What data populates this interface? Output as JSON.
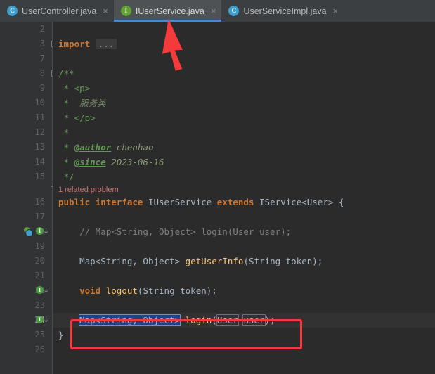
{
  "window": {
    "app": "IntelliJ IDEA",
    "editor_background": "#2b2b2b",
    "gutter_background": "#313335",
    "tabbar_background": "#3c3f41",
    "active_tab_background": "#4e5254",
    "accent": "#4a88c7",
    "annotation_color": "#f43a3a"
  },
  "tabs": [
    {
      "label": "UserController.java",
      "icon": "java-class-icon",
      "icon_letter": "C",
      "icon_kind": "cls",
      "active": false,
      "close_glyph": "×"
    },
    {
      "label": "IUserService.java",
      "icon": "java-interface-icon",
      "icon_letter": "I",
      "icon_kind": "iface",
      "active": true,
      "close_glyph": "×"
    },
    {
      "label": "UserServiceImpl.java",
      "icon": "java-class-icon",
      "icon_letter": "C",
      "icon_kind": "cls",
      "active": false,
      "close_glyph": "×"
    }
  ],
  "editor": {
    "inlay_hint": "1 related problem",
    "folded_placeholder": "...",
    "lines": [
      {
        "n": "2",
        "text": ""
      },
      {
        "n": "3",
        "text": "import ..."
      },
      {
        "n": "7",
        "text": ""
      },
      {
        "n": "8",
        "text": "/**"
      },
      {
        "n": "9",
        "text": " * <p>"
      },
      {
        "n": "10",
        "text": " *  服务类"
      },
      {
        "n": "11",
        "text": " * </p>"
      },
      {
        "n": "12",
        "text": " *"
      },
      {
        "n": "13",
        "text": " * @author chenhao"
      },
      {
        "n": "14",
        "text": " * @since 2023-06-16"
      },
      {
        "n": "15",
        "text": " */"
      },
      {
        "n": "16",
        "text": "public interface IUserService extends IService<User> {"
      },
      {
        "n": "17",
        "text": ""
      },
      {
        "n": "18",
        "text": "    // Map<String, Object> login(User user);"
      },
      {
        "n": "19",
        "text": ""
      },
      {
        "n": "20",
        "text": "    Map<String, Object> getUserInfo(String token);"
      },
      {
        "n": "21",
        "text": ""
      },
      {
        "n": "22",
        "text": "    void logout(String token);"
      },
      {
        "n": "23",
        "text": ""
      },
      {
        "n": "24",
        "text": "    Map<String, Object> login(User user);"
      },
      {
        "n": "25",
        "text": "}"
      },
      {
        "n": "26",
        "text": ""
      }
    ],
    "javadoc": {
      "author_tag": "@author",
      "author_value": "chenhao",
      "since_tag": "@since",
      "since_value": "2023-06-16",
      "body_text": "服务类",
      "open_p": "<p>",
      "close_p": "</p>"
    },
    "declaration": {
      "modifier": "public",
      "keyword": "interface",
      "name": "IUserService",
      "extends_kw": "extends",
      "supertype": "IService<User>",
      "brace": "{"
    },
    "methods": [
      {
        "line": "18",
        "commented": true,
        "return_type": "Map<String, Object>",
        "name": "login",
        "params": "User user"
      },
      {
        "line": "20",
        "commented": false,
        "return_type": "Map<String, Object>",
        "name": "getUserInfo",
        "params": "String token"
      },
      {
        "line": "22",
        "commented": false,
        "return_type": "void",
        "name": "logout",
        "params": "String token"
      },
      {
        "line": "24",
        "commented": false,
        "return_type": "Map<String, Object>",
        "name": "login",
        "params": "User user"
      }
    ],
    "selection": {
      "text": "Map<String, Object>",
      "background": "#214283",
      "border": "#6897bb"
    },
    "template_placeholders": [
      "User",
      "user"
    ],
    "current_line": "24",
    "gutter_icons": [
      {
        "line": "16",
        "name": "implemented-interface-marker"
      },
      {
        "line": "16",
        "name": "overridden-member-marker"
      },
      {
        "line": "20",
        "name": "implemented-method-marker"
      },
      {
        "line": "22",
        "name": "implemented-method-marker"
      }
    ]
  },
  "code_tokens": {
    "line3": {
      "kw": "import",
      "fold": "..."
    },
    "line24": {
      "sel": "Map<String, Object>",
      "method": "login",
      "lparen": "(",
      "ph1": "User",
      "space": " ",
      "ph2": "user",
      "rparen": ")",
      "semi": ";"
    }
  }
}
